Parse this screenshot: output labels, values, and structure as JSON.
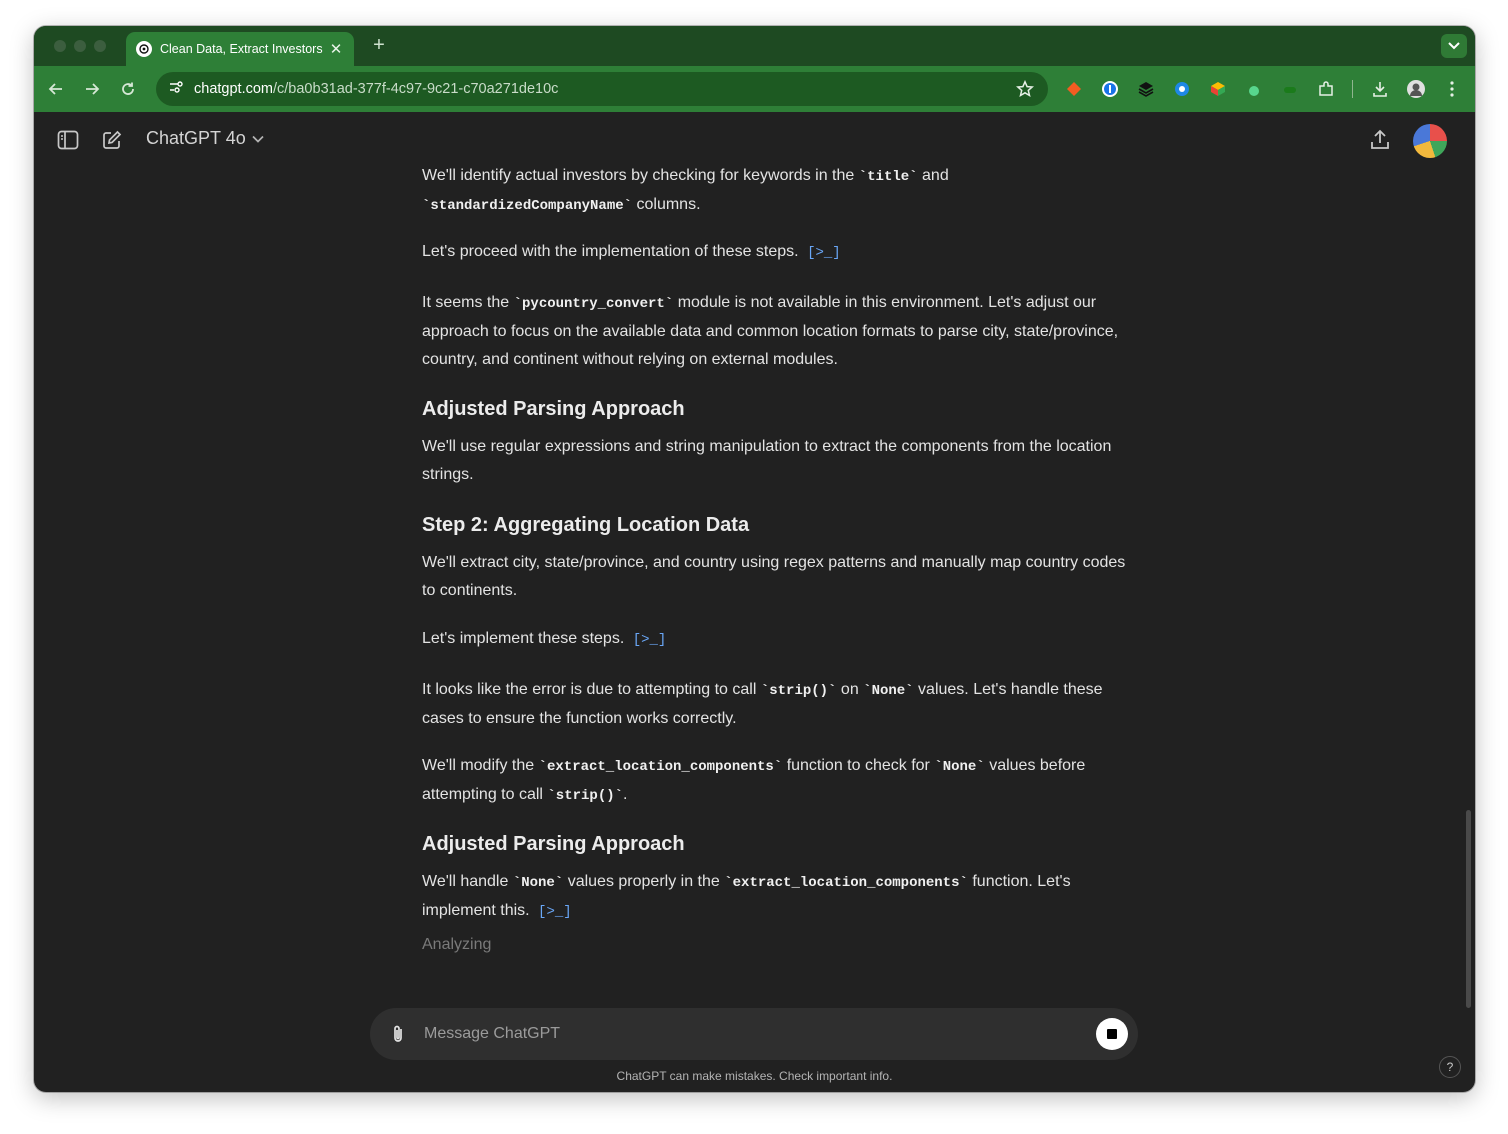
{
  "browser": {
    "tab_title": "Clean Data, Extract Investors",
    "url_host": "chatgpt.com",
    "url_path": "/c/ba0b31ad-377f-4c97-9c21-c70a271de10c",
    "accent": "#2e7f37"
  },
  "app": {
    "model_label": "ChatGPT 4o"
  },
  "messages": {
    "p1_a": "We'll identify actual investors by checking for keywords in the",
    "p1_code1": "`title`",
    "p1_b": "and",
    "p1_code2": "`standardizedCompanyName`",
    "p1_c": "columns.",
    "p2": "Let's proceed with the implementation of these steps.",
    "p3_a": "It seems the",
    "p3_code": "`pycountry_convert`",
    "p3_b": "module is not available in this environment. Let's adjust our approach to focus on the available data and common location formats to parse city, state/province, country, and continent without relying on external modules.",
    "h1": "Adjusted Parsing Approach",
    "p4": "We'll use regular expressions and string manipulation to extract the components from the location strings.",
    "h2": "Step 2: Aggregating Location Data",
    "p5": "We'll extract city, state/province, and country using regex patterns and manually map country codes to continents.",
    "p6": "Let's implement these steps.",
    "p7_a": "It looks like the error is due to attempting to call",
    "p7_code1": "`strip()`",
    "p7_b": "on",
    "p7_code2": "`None`",
    "p7_c": "values. Let's handle these cases to ensure the function works correctly.",
    "p8_a": "We'll modify the",
    "p8_code1": "`extract_location_components`",
    "p8_b": "function to check for",
    "p8_code2": "`None`",
    "p8_c": "values before attempting to call",
    "p8_code3": "`strip()`",
    "p8_d": ".",
    "h3": "Adjusted Parsing Approach",
    "p9_a": "We'll handle",
    "p9_code1": "`None`",
    "p9_b": "values properly in the",
    "p9_code2": "`extract_location_components`",
    "p9_c": "function. Let's implement this.",
    "analyzing": "Analyzing"
  },
  "composer": {
    "placeholder": "Message ChatGPT",
    "disclaimer": "ChatGPT can make mistakes. Check important info."
  },
  "help_label": "?"
}
